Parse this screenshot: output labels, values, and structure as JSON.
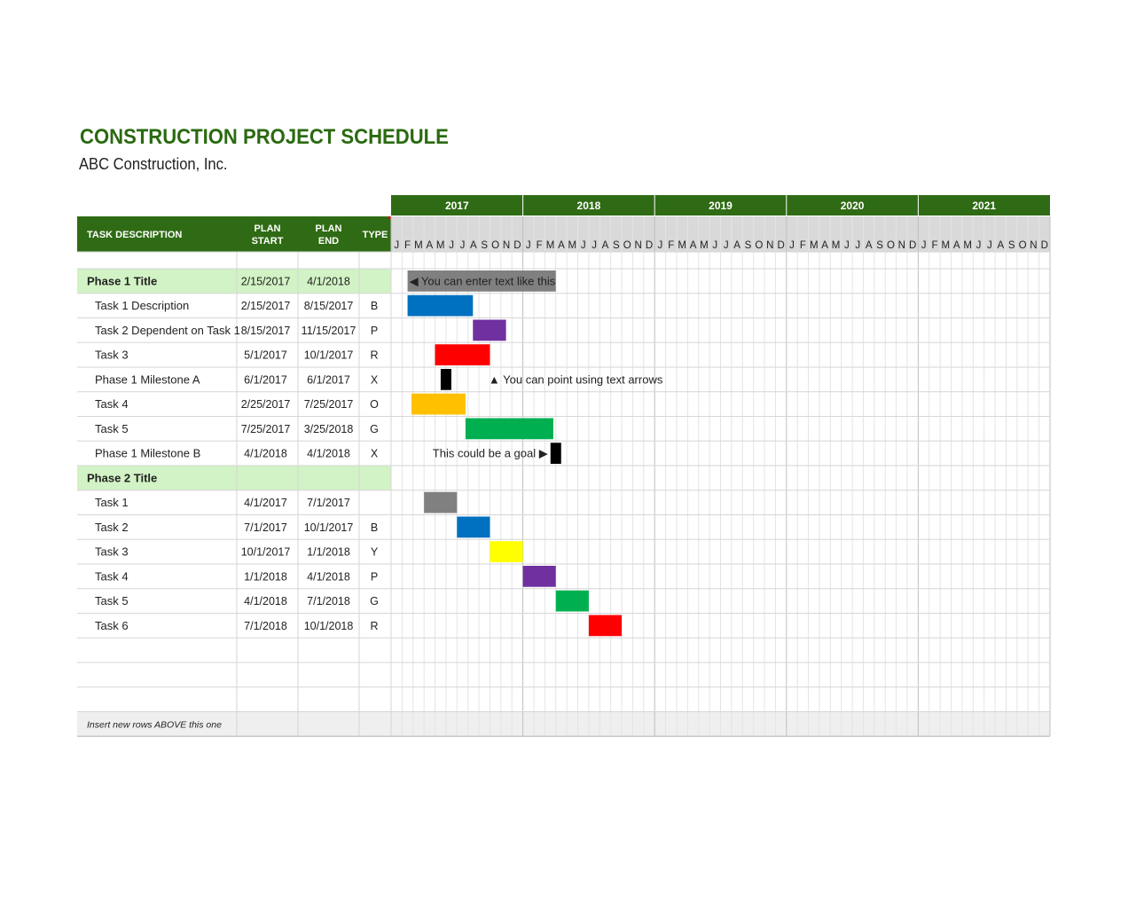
{
  "title": "CONSTRUCTION PROJECT SCHEDULE",
  "subtitle": "ABC Construction, Inc.",
  "colors": {
    "header_green": "#2f6b14",
    "phase_fill": "#d2f3c5",
    "timeline_header": "#d9d9d9",
    "footer_fill": "#efefef",
    "B": "#0070c0",
    "P": "#7030a0",
    "R": "#ff0000",
    "X": "#000000",
    "O": "#ffc000",
    "G": "#00b050",
    "Y": "#ffff00",
    "none": "#808080"
  },
  "columns": {
    "task": "TASK DESCRIPTION",
    "start": [
      "PLAN",
      "START"
    ],
    "end": [
      "PLAN",
      "END"
    ],
    "type": "TYPE"
  },
  "footer_note": "Insert new rows ABOVE this one",
  "chart_data": {
    "type": "gantt",
    "years": [
      "2017",
      "2018",
      "2019",
      "2020",
      "2021"
    ],
    "month_letters": [
      "J",
      "F",
      "M",
      "A",
      "M",
      "J",
      "J",
      "A",
      "S",
      "O",
      "N",
      "D"
    ],
    "timeline_start": "1/1/2017",
    "timeline_end": "1/1/2022",
    "rows": [
      {
        "kind": "phase",
        "task": "Phase 1 Title",
        "start": "2/15/2017",
        "end": "4/1/2018",
        "type": "",
        "bar_label": "◀ You can enter text like this"
      },
      {
        "kind": "task",
        "task": "Task 1 Description",
        "start": "2/15/2017",
        "end": "8/15/2017",
        "type": "B"
      },
      {
        "kind": "task",
        "task": "Task 2 Dependent on Task 1",
        "start": "8/15/2017",
        "end": "11/15/2017",
        "type": "P"
      },
      {
        "kind": "task",
        "task": "Task 3",
        "start": "5/1/2017",
        "end": "10/1/2017",
        "type": "R"
      },
      {
        "kind": "task",
        "task": "Phase 1 Milestone A",
        "start": "6/1/2017",
        "end": "6/1/2017",
        "type": "X",
        "note_after": "▲ You can point using text arrows"
      },
      {
        "kind": "task",
        "task": "Task 4",
        "start": "2/25/2017",
        "end": "7/25/2017",
        "type": "O"
      },
      {
        "kind": "task",
        "task": "Task 5",
        "start": "7/25/2017",
        "end": "3/25/2018",
        "type": "G"
      },
      {
        "kind": "task",
        "task": "Phase 1 Milestone B",
        "start": "4/1/2018",
        "end": "4/1/2018",
        "type": "X",
        "note_before": "This could be a goal ▶"
      },
      {
        "kind": "phase",
        "task": "Phase 2 Title",
        "start": "",
        "end": "",
        "type": ""
      },
      {
        "kind": "task",
        "task": "Task 1",
        "start": "4/1/2017",
        "end": "7/1/2017",
        "type": ""
      },
      {
        "kind": "task",
        "task": "Task 2",
        "start": "7/1/2017",
        "end": "10/1/2017",
        "type": "B"
      },
      {
        "kind": "task",
        "task": "Task 3",
        "start": "10/1/2017",
        "end": "1/1/2018",
        "type": "Y"
      },
      {
        "kind": "task",
        "task": "Task 4",
        "start": "1/1/2018",
        "end": "4/1/2018",
        "type": "P"
      },
      {
        "kind": "task",
        "task": "Task 5",
        "start": "4/1/2018",
        "end": "7/1/2018",
        "type": "G"
      },
      {
        "kind": "task",
        "task": "Task 6",
        "start": "7/1/2018",
        "end": "10/1/2018",
        "type": "R"
      }
    ]
  }
}
